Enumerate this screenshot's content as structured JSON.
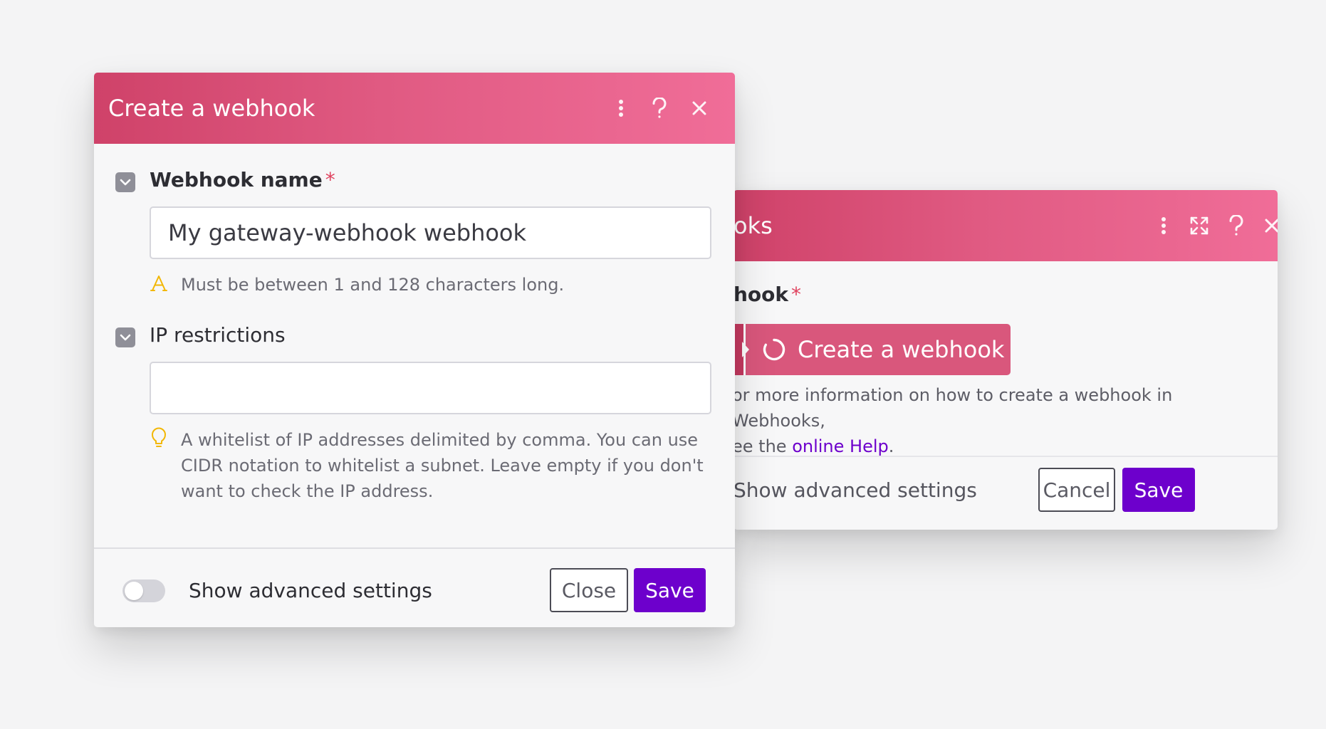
{
  "front_dialog": {
    "title": "Create a webhook",
    "header_icons": [
      "more-vertical-icon",
      "help-icon",
      "close-icon"
    ],
    "fields": [
      {
        "label": "Webhook name",
        "required": true,
        "required_mark": "*",
        "value": "My gateway-webhook webhook",
        "hint_icon": "text-format-icon",
        "hint": "Must be between 1 and 128 characters long."
      },
      {
        "label": "IP restrictions",
        "required": false,
        "value": "",
        "hint_icon": "lightbulb-icon",
        "hint": "A whitelist of IP addresses delimited by comma. You can use CIDR notation to whitelist a subnet. Leave empty if you don't want to check the IP address."
      }
    ],
    "footer": {
      "toggle_label": "Show advanced settings",
      "toggle_on": false,
      "close_label": "Close",
      "save_label": "Save"
    }
  },
  "back_dialog": {
    "title_partial": "oks",
    "header_icons": [
      "more-vertical-icon",
      "expand-icon",
      "help-icon",
      "close-icon"
    ],
    "field_label_partial": "hook",
    "required_mark": "*",
    "create_button_label": "Create a webhook",
    "help_line1": "or more information on how to create a webhook in Webhooks,",
    "help_line2_prefix": "ee the ",
    "help_link": "online Help",
    "help_line2_suffix": ".",
    "footer": {
      "advanced_label": "Show advanced settings",
      "cancel_label": "Cancel",
      "save_label": "Save"
    }
  },
  "colors": {
    "header_gradient_start": "#cf4269",
    "header_gradient_end": "#f06d98",
    "primary_button": "#6d00cc",
    "link": "#6d00cc",
    "required": "#e0435f",
    "hint_icon": "#f2b705"
  }
}
